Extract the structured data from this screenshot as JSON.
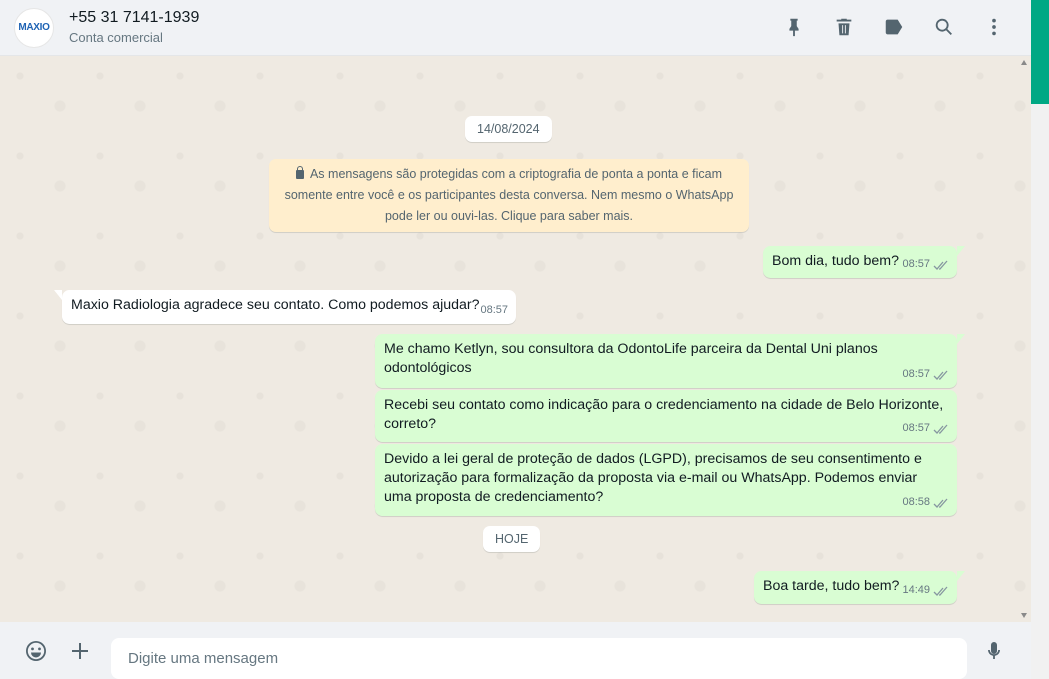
{
  "header": {
    "avatar_text": "MAXIO",
    "contact_name": "+55 31 7141-1939",
    "contact_subtitle": "Conta comercial",
    "icons": [
      "pin-icon",
      "delete-icon",
      "label-icon",
      "search-icon",
      "menu-icon"
    ]
  },
  "colors": {
    "accent": "#00a884",
    "outgoing_bubble": "#d9fdd3",
    "incoming_bubble": "#ffffff",
    "system_bubble": "#ffeecd",
    "header_bg": "#f0f2f5",
    "chat_bg": "#efeae2"
  },
  "chat": {
    "date_1": "14/08/2024",
    "encryption_notice": "As mensagens são protegidas com a criptografia de ponta a ponta e ficam somente entre você e os participantes desta conversa. Nem mesmo o WhatsApp pode ler ou ouvi-las. Clique para saber mais.",
    "messages": [
      {
        "direction": "out",
        "text": "Bom dia, tudo bem?",
        "time": "08:57",
        "status": "read"
      },
      {
        "direction": "in",
        "text": "Maxio Radiologia agradece seu contato. Como podemos ajudar?",
        "time": "08:57"
      },
      {
        "direction": "out",
        "text": "Me chamo Ketlyn, sou consultora da OdontoLife parceira da Dental Uni planos odontológicos",
        "time": "08:57",
        "status": "read"
      },
      {
        "direction": "out",
        "text": "Recebi seu contato como indicação para o credenciamento na cidade de Belo Horizonte, correto?",
        "time": "08:57",
        "status": "read"
      },
      {
        "direction": "out",
        "text": "Devido a lei geral de proteção de dados (LGPD), precisamos de seu consentimento e autorização para formalização da proposta via e-mail ou WhatsApp. Podemos enviar uma proposta de credenciamento?",
        "time": "08:58",
        "status": "read"
      },
      {
        "direction": "out",
        "text": "Boa tarde, tudo bem?",
        "time": "14:49",
        "status": "read"
      }
    ],
    "date_2": "HOJE"
  },
  "footer": {
    "input_placeholder": "Digite uma mensagem",
    "icons": [
      "emoji-icon",
      "attach-plus-icon",
      "mic-icon"
    ]
  }
}
